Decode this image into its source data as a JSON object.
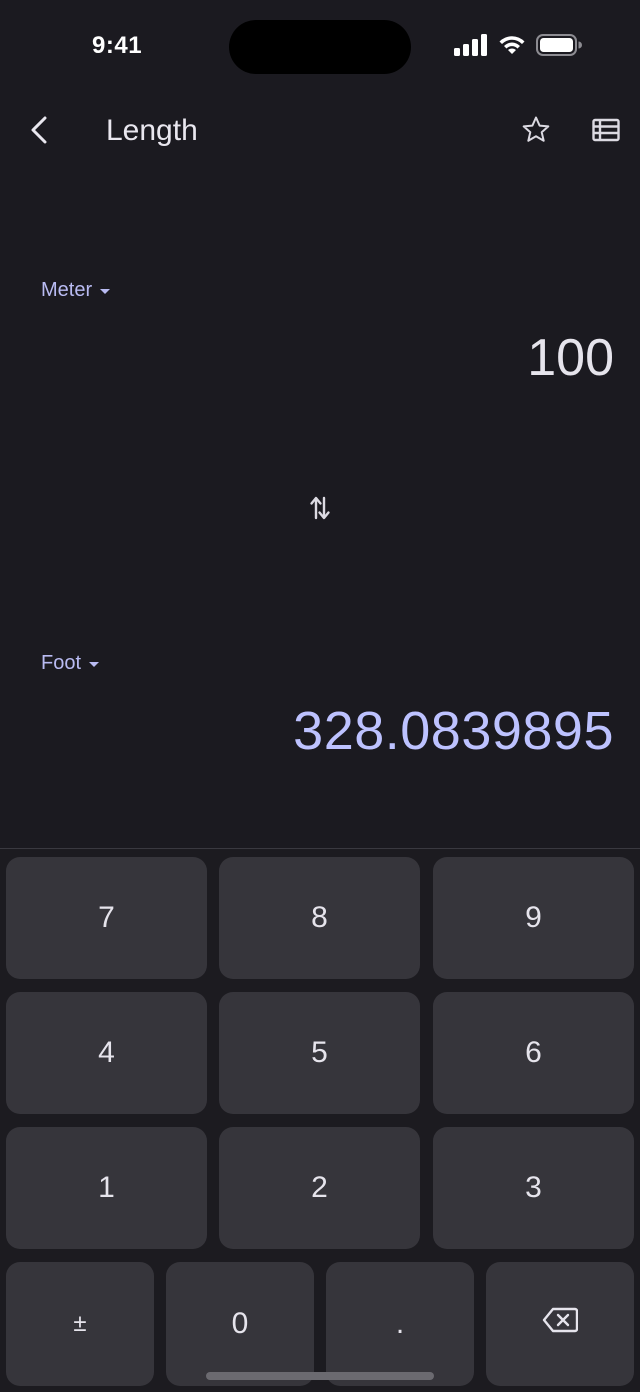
{
  "status_bar": {
    "time": "9:41"
  },
  "toolbar": {
    "title": "Length",
    "back_icon": "chevron-left-icon",
    "favorite_icon": "star-outline-icon",
    "list_icon": "table-list-icon"
  },
  "converter": {
    "from_unit": "Meter",
    "from_value": "100",
    "to_unit": "Foot",
    "to_value": "328.0839895",
    "swap_icon": "swap-vertical-icon"
  },
  "keypad": {
    "rows": [
      [
        "7",
        "8",
        "9"
      ],
      [
        "4",
        "5",
        "6"
      ],
      [
        "1",
        "2",
        "3"
      ],
      [
        "±",
        "0",
        "."
      ]
    ],
    "backspace_icon": "backspace-icon"
  },
  "colors": {
    "background": "#1b1a20",
    "key": "#36353b",
    "accent": "#bdc2ff",
    "text": "#e6e4ec"
  }
}
